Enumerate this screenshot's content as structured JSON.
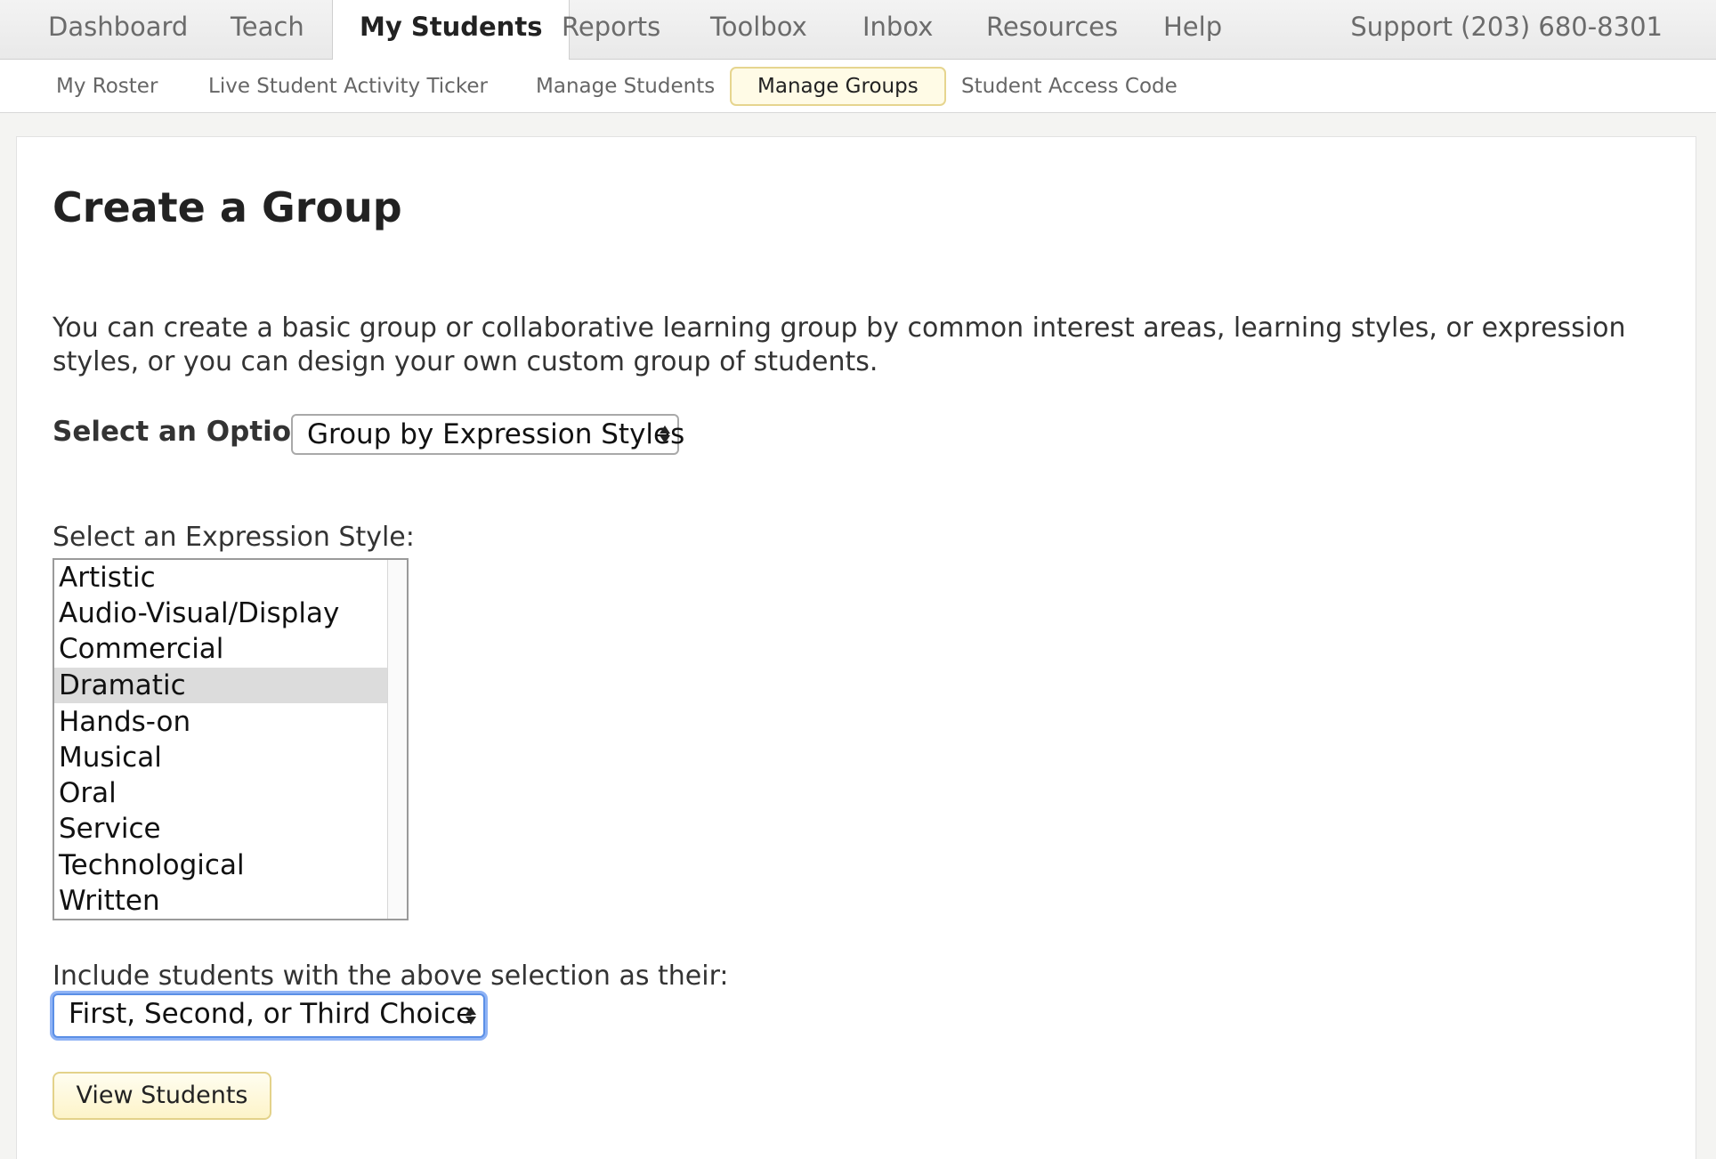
{
  "topnav": {
    "tabs": [
      {
        "label": "Dashboard"
      },
      {
        "label": "Teach"
      },
      {
        "label": "My Students",
        "active": true
      },
      {
        "label": "Reports"
      },
      {
        "label": "Toolbox"
      },
      {
        "label": "Inbox"
      },
      {
        "label": "Resources"
      },
      {
        "label": "Help"
      }
    ],
    "support": "Support (203) 680-8301"
  },
  "subnav": {
    "items": [
      {
        "label": "My Roster"
      },
      {
        "label": "Live Student Activity Ticker"
      },
      {
        "label": "Manage Students"
      },
      {
        "label": "Manage Groups",
        "active": true
      },
      {
        "label": "Student Access Code"
      }
    ]
  },
  "main": {
    "title": "Create a Group",
    "description": "You can create a basic group or collaborative learning group by common interest areas, learning styles, or expression styles, or you can design your own custom group of students.",
    "option_label": "Select an Option:",
    "option_value": "Group by Expression Styles",
    "style_label": "Select an Expression Style:",
    "styles": [
      "Artistic",
      "Audio-Visual/Display",
      "Commercial",
      "Dramatic",
      "Hands-on",
      "Musical",
      "Oral",
      "Service",
      "Technological",
      "Written"
    ],
    "selected_style": "Dramatic",
    "include_label": "Include students with the above selection as their:",
    "choice_value": "First, Second, or Third Choice",
    "view_button": "View Students"
  },
  "colors": {
    "active_sub_bg": "#fffbe6",
    "active_sub_border": "#e6d58f",
    "focus_ring": "#5b8fe6",
    "selected_row": "#dcdcdc"
  }
}
